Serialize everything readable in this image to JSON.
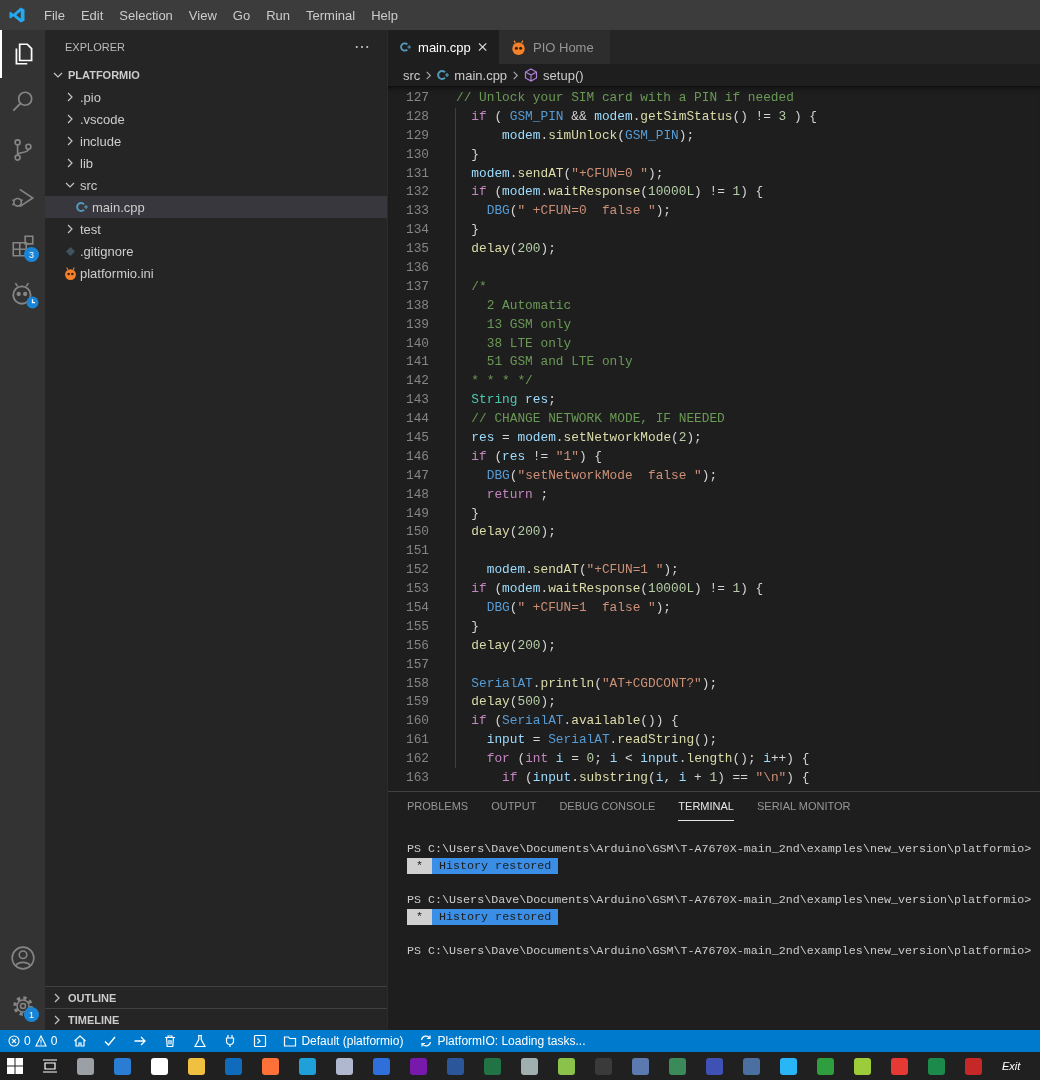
{
  "menu": [
    "File",
    "Edit",
    "Selection",
    "View",
    "Go",
    "Run",
    "Terminal",
    "Help"
  ],
  "activity_bar": {
    "top": [
      {
        "kind": "explorer",
        "selected": true
      },
      {
        "kind": "search",
        "selected": false
      },
      {
        "kind": "source-control",
        "selected": false
      },
      {
        "kind": "run-debug",
        "selected": false
      },
      {
        "kind": "extensions",
        "selected": false,
        "badge": "3"
      },
      {
        "kind": "platformio",
        "selected": false
      }
    ],
    "bottom": [
      {
        "kind": "account",
        "selected": false
      },
      {
        "kind": "settings",
        "selected": false,
        "badge": "1"
      }
    ]
  },
  "sidebar": {
    "title": "EXPLORER",
    "tree": [
      {
        "label": "PLATFORMIO",
        "kind": "root",
        "expanded": true,
        "selected": false,
        "children": [
          {
            "label": ".pio",
            "kind": "folder",
            "expanded": false,
            "selected": false
          },
          {
            "label": ".vscode",
            "kind": "folder",
            "expanded": false,
            "selected": false
          },
          {
            "label": "include",
            "kind": "folder",
            "expanded": false,
            "selected": false
          },
          {
            "label": "lib",
            "kind": "folder",
            "expanded": false,
            "selected": false
          },
          {
            "label": "src",
            "kind": "folder",
            "expanded": true,
            "selected": false,
            "children": [
              {
                "label": "main.cpp",
                "kind": "cpp",
                "selected": true
              }
            ]
          },
          {
            "label": "test",
            "kind": "folder",
            "expanded": false,
            "selected": false
          },
          {
            "label": ".gitignore",
            "kind": "git",
            "selected": false
          },
          {
            "label": "platformio.ini",
            "kind": "pio",
            "selected": false
          }
        ]
      }
    ],
    "sections": [
      {
        "label": "OUTLINE",
        "expanded": false
      },
      {
        "label": "TIMELINE",
        "expanded": false
      }
    ]
  },
  "editor": {
    "tabs": [
      {
        "label": "main.cpp",
        "kind": "cpp",
        "selected": true
      },
      {
        "label": "PIO Home",
        "kind": "pio",
        "selected": false
      }
    ],
    "breadcrumb": [
      {
        "label": "src",
        "kind": "folder"
      },
      {
        "label": "main.cpp",
        "kind": "cpp"
      },
      {
        "label": "setup()",
        "kind": "method"
      }
    ],
    "lines": [
      {
        "number": "127",
        "tokens": [
          {
            "kind": "comment",
            "text": "// Unlock your SIM card with a PIN if needed"
          }
        ]
      },
      {
        "number": "128",
        "tokens": [
          {
            "kind": "keyword",
            "text": "  if"
          },
          {
            "kind": "plain",
            "text": " ( "
          },
          {
            "kind": "macro",
            "text": "GSM_PIN"
          },
          {
            "kind": "plain",
            "text": " && "
          },
          {
            "kind": "variable",
            "text": "modem"
          },
          {
            "kind": "plain",
            "text": "."
          },
          {
            "kind": "function",
            "text": "getSimStatus"
          },
          {
            "kind": "plain",
            "text": "() != "
          },
          {
            "kind": "number",
            "text": "3"
          },
          {
            "kind": "plain",
            "text": " ) {"
          }
        ]
      },
      {
        "number": "129",
        "tokens": [
          {
            "kind": "variable",
            "text": "      modem"
          },
          {
            "kind": "plain",
            "text": "."
          },
          {
            "kind": "function",
            "text": "simUnlock"
          },
          {
            "kind": "plain",
            "text": "("
          },
          {
            "kind": "macro",
            "text": "GSM_PIN"
          },
          {
            "kind": "plain",
            "text": ");"
          }
        ]
      },
      {
        "number": "130",
        "tokens": [
          {
            "kind": "plain",
            "text": "  }"
          }
        ]
      },
      {
        "number": "131",
        "tokens": [
          {
            "kind": "variable",
            "text": "  modem"
          },
          {
            "kind": "plain",
            "text": "."
          },
          {
            "kind": "function",
            "text": "sendAT"
          },
          {
            "kind": "plain",
            "text": "("
          },
          {
            "kind": "string",
            "text": "\"+CFUN=0 \""
          },
          {
            "kind": "plain",
            "text": ");"
          }
        ]
      },
      {
        "number": "132",
        "tokens": [
          {
            "kind": "keyword",
            "text": "  if"
          },
          {
            "kind": "plain",
            "text": " ("
          },
          {
            "kind": "variable",
            "text": "modem"
          },
          {
            "kind": "plain",
            "text": "."
          },
          {
            "kind": "function",
            "text": "waitResponse"
          },
          {
            "kind": "plain",
            "text": "("
          },
          {
            "kind": "number",
            "text": "10000L"
          },
          {
            "kind": "plain",
            "text": ") != "
          },
          {
            "kind": "number",
            "text": "1"
          },
          {
            "kind": "plain",
            "text": ") {"
          }
        ]
      },
      {
        "number": "133",
        "tokens": [
          {
            "kind": "macro",
            "text": "    DBG"
          },
          {
            "kind": "plain",
            "text": "("
          },
          {
            "kind": "string",
            "text": "\" +CFUN=0  false \""
          },
          {
            "kind": "plain",
            "text": ");"
          }
        ]
      },
      {
        "number": "134",
        "tokens": [
          {
            "kind": "plain",
            "text": "  }"
          }
        ]
      },
      {
        "number": "135",
        "tokens": [
          {
            "kind": "function",
            "text": "  delay"
          },
          {
            "kind": "plain",
            "text": "("
          },
          {
            "kind": "number",
            "text": "200"
          },
          {
            "kind": "plain",
            "text": ");"
          }
        ]
      },
      {
        "number": "136"
      },
      {
        "number": "137",
        "tokens": [
          {
            "kind": "comment",
            "text": "  /*"
          }
        ]
      },
      {
        "number": "138",
        "tokens": [
          {
            "kind": "comment",
            "text": "    2 Automatic"
          }
        ]
      },
      {
        "number": "139",
        "tokens": [
          {
            "kind": "comment",
            "text": "    13 GSM only"
          }
        ]
      },
      {
        "number": "140",
        "tokens": [
          {
            "kind": "comment",
            "text": "    38 LTE only"
          }
        ]
      },
      {
        "number": "141",
        "tokens": [
          {
            "kind": "comment",
            "text": "    51 GSM and LTE only"
          }
        ]
      },
      {
        "number": "142",
        "tokens": [
          {
            "kind": "comment",
            "text": "  * * * */"
          }
        ]
      },
      {
        "number": "143",
        "tokens": [
          {
            "kind": "type",
            "text": "  String"
          },
          {
            "kind": "variable",
            "text": " res"
          },
          {
            "kind": "plain",
            "text": ";"
          }
        ]
      },
      {
        "number": "144",
        "tokens": [
          {
            "kind": "comment",
            "text": "  // CHANGE NETWORK MODE, IF NEEDED"
          }
        ]
      },
      {
        "number": "145",
        "tokens": [
          {
            "kind": "variable",
            "text": "  res"
          },
          {
            "kind": "plain",
            "text": " = "
          },
          {
            "kind": "variable",
            "text": "modem"
          },
          {
            "kind": "plain",
            "text": "."
          },
          {
            "kind": "function",
            "text": "setNetworkMode"
          },
          {
            "kind": "plain",
            "text": "("
          },
          {
            "kind": "number",
            "text": "2"
          },
          {
            "kind": "plain",
            "text": ");"
          }
        ]
      },
      {
        "number": "146",
        "tokens": [
          {
            "kind": "keyword",
            "text": "  if"
          },
          {
            "kind": "plain",
            "text": " ("
          },
          {
            "kind": "variable",
            "text": "res"
          },
          {
            "kind": "plain",
            "text": " != "
          },
          {
            "kind": "string",
            "text": "\"1\""
          },
          {
            "kind": "plain",
            "text": ") {"
          }
        ]
      },
      {
        "number": "147",
        "tokens": [
          {
            "kind": "macro",
            "text": "    DBG"
          },
          {
            "kind": "plain",
            "text": "("
          },
          {
            "kind": "string",
            "text": "\"setNetworkMode  false \""
          },
          {
            "kind": "plain",
            "text": ");"
          }
        ]
      },
      {
        "number": "148",
        "tokens": [
          {
            "kind": "keyword",
            "text": "    return"
          },
          {
            "kind": "plain",
            "text": " ;"
          }
        ]
      },
      {
        "number": "149",
        "tokens": [
          {
            "kind": "plain",
            "text": "  }"
          }
        ]
      },
      {
        "number": "150",
        "tokens": [
          {
            "kind": "function",
            "text": "  delay"
          },
          {
            "kind": "plain",
            "text": "("
          },
          {
            "kind": "number",
            "text": "200"
          },
          {
            "kind": "plain",
            "text": ");"
          }
        ]
      },
      {
        "number": "151"
      },
      {
        "number": "152",
        "tokens": [
          {
            "kind": "variable",
            "text": "    modem"
          },
          {
            "kind": "plain",
            "text": "."
          },
          {
            "kind": "function",
            "text": "sendAT"
          },
          {
            "kind": "plain",
            "text": "("
          },
          {
            "kind": "string",
            "text": "\"+CFUN=1 \""
          },
          {
            "kind": "plain",
            "text": ");"
          }
        ]
      },
      {
        "number": "153",
        "tokens": [
          {
            "kind": "keyword",
            "text": "  if"
          },
          {
            "kind": "plain",
            "text": " ("
          },
          {
            "kind": "variable",
            "text": "modem"
          },
          {
            "kind": "plain",
            "text": "."
          },
          {
            "kind": "function",
            "text": "waitResponse"
          },
          {
            "kind": "plain",
            "text": "("
          },
          {
            "kind": "number",
            "text": "10000L"
          },
          {
            "kind": "plain",
            "text": ") != "
          },
          {
            "kind": "number",
            "text": "1"
          },
          {
            "kind": "plain",
            "text": ") {"
          }
        ]
      },
      {
        "number": "154",
        "tokens": [
          {
            "kind": "macro",
            "text": "    DBG"
          },
          {
            "kind": "plain",
            "text": "("
          },
          {
            "kind": "string",
            "text": "\" +CFUN=1  false \""
          },
          {
            "kind": "plain",
            "text": ");"
          }
        ]
      },
      {
        "number": "155",
        "tokens": [
          {
            "kind": "plain",
            "text": "  }"
          }
        ]
      },
      {
        "number": "156",
        "tokens": [
          {
            "kind": "function",
            "text": "  delay"
          },
          {
            "kind": "plain",
            "text": "("
          },
          {
            "kind": "number",
            "text": "200"
          },
          {
            "kind": "plain",
            "text": ");"
          }
        ]
      },
      {
        "number": "157"
      },
      {
        "number": "158",
        "tokens": [
          {
            "kind": "macro",
            "text": "  SerialAT"
          },
          {
            "kind": "plain",
            "text": "."
          },
          {
            "kind": "function",
            "text": "println"
          },
          {
            "kind": "plain",
            "text": "("
          },
          {
            "kind": "string",
            "text": "\"AT+CGDCONT?\""
          },
          {
            "kind": "plain",
            "text": ");"
          }
        ]
      },
      {
        "number": "159",
        "tokens": [
          {
            "kind": "function",
            "text": "  delay"
          },
          {
            "kind": "plain",
            "text": "("
          },
          {
            "kind": "number",
            "text": "500"
          },
          {
            "kind": "plain",
            "text": ");"
          }
        ]
      },
      {
        "number": "160",
        "tokens": [
          {
            "kind": "keyword",
            "text": "  if"
          },
          {
            "kind": "plain",
            "text": " ("
          },
          {
            "kind": "macro",
            "text": "SerialAT"
          },
          {
            "kind": "plain",
            "text": "."
          },
          {
            "kind": "function",
            "text": "available"
          },
          {
            "kind": "plain",
            "text": "()) {"
          }
        ]
      },
      {
        "number": "161",
        "tokens": [
          {
            "kind": "variable",
            "text": "    input"
          },
          {
            "kind": "plain",
            "text": " = "
          },
          {
            "kind": "macro",
            "text": "SerialAT"
          },
          {
            "kind": "plain",
            "text": "."
          },
          {
            "kind": "function",
            "text": "readString"
          },
          {
            "kind": "plain",
            "text": "();"
          }
        ]
      },
      {
        "number": "162",
        "tokens": [
          {
            "kind": "keyword",
            "text": "    for"
          },
          {
            "kind": "plain",
            "text": " ("
          },
          {
            "kind": "keyword",
            "text": "int"
          },
          {
            "kind": "variable",
            "text": " i"
          },
          {
            "kind": "plain",
            "text": " = "
          },
          {
            "kind": "number",
            "text": "0"
          },
          {
            "kind": "plain",
            "text": "; "
          },
          {
            "kind": "variable",
            "text": "i"
          },
          {
            "kind": "plain",
            "text": " < "
          },
          {
            "kind": "variable",
            "text": "input"
          },
          {
            "kind": "plain",
            "text": "."
          },
          {
            "kind": "function",
            "text": "length"
          },
          {
            "kind": "plain",
            "text": "(); "
          },
          {
            "kind": "variable",
            "text": "i"
          },
          {
            "kind": "plain",
            "text": "++) {"
          }
        ]
      },
      {
        "number": "163",
        "tokens": [
          {
            "kind": "keyword",
            "text": "      if"
          },
          {
            "kind": "plain",
            "text": " ("
          },
          {
            "kind": "variable",
            "text": "input"
          },
          {
            "kind": "plain",
            "text": "."
          },
          {
            "kind": "function",
            "text": "substring"
          },
          {
            "kind": "plain",
            "text": "("
          },
          {
            "kind": "variable",
            "text": "i"
          },
          {
            "kind": "plain",
            "text": ", "
          },
          {
            "kind": "variable",
            "text": "i"
          },
          {
            "kind": "plain",
            "text": " + "
          },
          {
            "kind": "number",
            "text": "1"
          },
          {
            "kind": "plain",
            "text": ") == "
          },
          {
            "kind": "string",
            "text": "\"\\n\""
          },
          {
            "kind": "plain",
            "text": ") {"
          }
        ]
      }
    ]
  },
  "panel": {
    "tabs": [
      {
        "label": "PROBLEMS",
        "selected": false
      },
      {
        "label": "OUTPUT",
        "selected": false
      },
      {
        "label": "DEBUG CONSOLE",
        "selected": false
      },
      {
        "label": "TERMINAL",
        "selected": true
      },
      {
        "label": "SERIAL MONITOR",
        "selected": false
      }
    ],
    "terminal": [
      {
        "kind": "prompt",
        "text": "PS C:\\Users\\Dave\\Documents\\Arduino\\GSM\\T-A7670X-main_2nd\\examples\\new_version\\platformio>"
      },
      {
        "kind": "notice",
        "mark": "*",
        "text": "History restored"
      },
      {
        "kind": "prompt",
        "text": "PS C:\\Users\\Dave\\Documents\\Arduino\\GSM\\T-A7670X-main_2nd\\examples\\new_version\\platformio>"
      },
      {
        "kind": "notice",
        "mark": "*",
        "text": "History restored"
      },
      {
        "kind": "prompt",
        "text": "PS C:\\Users\\Dave\\Documents\\Arduino\\GSM\\T-A7670X-main_2nd\\examples\\new_version\\platformio>"
      }
    ]
  },
  "status_bar": {
    "errors": "0",
    "warnings": "0",
    "actions": [
      {
        "kind": "home"
      },
      {
        "kind": "check"
      },
      {
        "kind": "arrow"
      },
      {
        "kind": "trash"
      },
      {
        "kind": "flask"
      },
      {
        "kind": "plug"
      },
      {
        "kind": "terminal"
      }
    ],
    "items": [
      {
        "kind": "folder",
        "text": "Default (platformio)"
      },
      {
        "kind": "sync",
        "text": "PlatformIO: Loading tasks..."
      }
    ]
  },
  "taskbar": {
    "apps": [
      {
        "color": "#9aa0a6"
      },
      {
        "color": "#2b7cd3"
      },
      {
        "color": "#ffffff"
      },
      {
        "color": "#f0c040"
      },
      {
        "color": "#0f6cbd"
      },
      {
        "color": "#ff7139"
      },
      {
        "color": "#1fa0d8"
      },
      {
        "color": "#b0b8d0"
      },
      {
        "color": "#2f6fdb"
      },
      {
        "color": "#7719aa"
      },
      {
        "color": "#2b579a"
      },
      {
        "color": "#217346"
      },
      {
        "color": "#a0b0b0"
      },
      {
        "color": "#8bc34a"
      },
      {
        "color": "#3a3a3a"
      },
      {
        "color": "#5a7ab0"
      },
      {
        "color": "#3a8a5a"
      },
      {
        "color": "#3f51b5"
      },
      {
        "color": "#4a6fa0"
      },
      {
        "color": "#29b6f6"
      },
      {
        "color": "#2e9e3e"
      },
      {
        "color": "#9ccc3a"
      },
      {
        "color": "#e53935"
      },
      {
        "color": "#1b8a4a"
      },
      {
        "color": "#c62828"
      }
    ],
    "exit": "Exit"
  }
}
